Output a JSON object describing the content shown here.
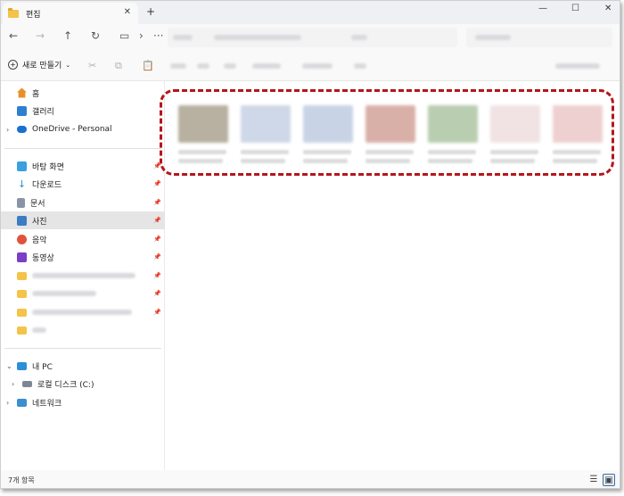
{
  "tab": {
    "title": "편집",
    "close": "✕",
    "new_tab": "+"
  },
  "window": {
    "minimize": "—",
    "maximize": "☐",
    "close": "✕"
  },
  "nav": {
    "back": "←",
    "forward": "→",
    "up": "↑",
    "refresh": "↻",
    "monitor": "▭",
    "chevron": "›",
    "more": "···"
  },
  "command_bar": {
    "new_label": "새로 만들기",
    "new_chevron": "⌄",
    "cut": "✂",
    "copy": "⧉",
    "paste": "📋"
  },
  "sidebar": {
    "home": "홈",
    "gallery": "갤러리",
    "onedrive": "OneDrive - Personal",
    "quick_access": [
      {
        "label": "바탕 화면",
        "color": "#3aa0e0"
      },
      {
        "label": "다운로드",
        "color": "#2e8bcf"
      },
      {
        "label": "문서",
        "color": "#8a94a6"
      },
      {
        "label": "사진",
        "color": "#3c7cc4"
      },
      {
        "label": "음악",
        "color": "#e0533c"
      },
      {
        "label": "동영상",
        "color": "#7b3fc6"
      }
    ],
    "this_pc": "내 PC",
    "local_disk": "로컬 디스크 (C:)",
    "network": "네트워크",
    "pin_icon": "📌",
    "expand_icon": "›",
    "collapse_icon": "⌄"
  },
  "thumbnails": [
    {
      "color": "#b8b0a0"
    },
    {
      "color": "#cfd8e8"
    },
    {
      "color": "#c9d3e6"
    },
    {
      "color": "#d9b0a8"
    },
    {
      "color": "#b9cdb0"
    },
    {
      "color": "#f1e3e3"
    },
    {
      "color": "#efd0d0"
    }
  ],
  "status": {
    "count": "7개 항목",
    "details_view": "☰",
    "tiles_view": "▣"
  },
  "colors": {
    "highlight": "#b3161b",
    "selected": "#e5e5e5"
  }
}
